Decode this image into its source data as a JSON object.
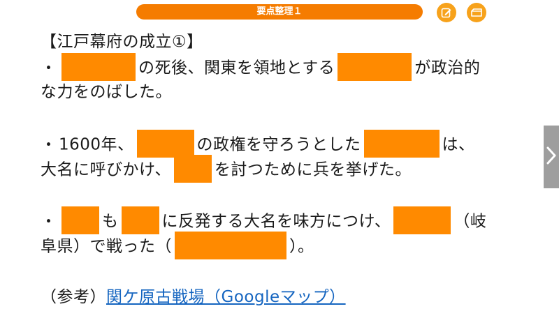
{
  "header": {
    "title": "要点整理１",
    "edit_icon": "edit-note-icon",
    "card_icon": "card-icon"
  },
  "content": {
    "heading": "【江戸幕府の成立①】",
    "bullet": "・",
    "p1": {
      "t1": "の死後、関東を領地とする",
      "t2": "が政治的",
      "line2": "な力をのばした。"
    },
    "p2": {
      "t0": "1600年、",
      "t1": "の政権を守ろうとした",
      "t2": "は、",
      "t3": "大名に呼びかけ、",
      "t4": "を討つために兵を挙げた。"
    },
    "p3": {
      "t1": "も",
      "t2": "に反発する大名を味方につけ、",
      "t3": "（岐",
      "t4": "阜県）で戦った（",
      "t5": "）。"
    },
    "reference": {
      "label": "（参考）",
      "link_text": "関ケ原古戦場（Googleマップ）"
    }
  },
  "nav": {
    "next_icon": "chevron-right-icon"
  },
  "colors": {
    "accent": "#f57c00",
    "button": "#f7a21b",
    "mask": "#ff8a00",
    "link": "#1565c0",
    "side_tab": "#9e9e9e"
  }
}
